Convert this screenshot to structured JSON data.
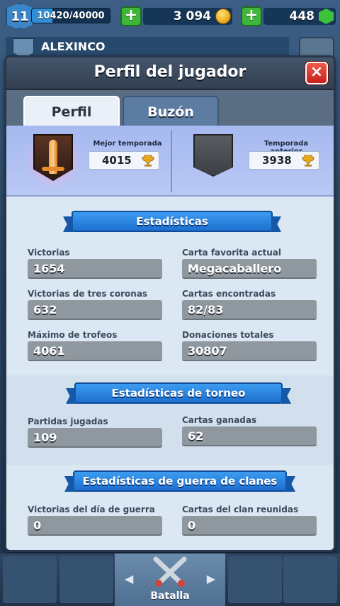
{
  "hud": {
    "level": "11",
    "xp_text": "10420/40000",
    "xp_fraction": 0.2605,
    "gold": "3 094",
    "gems": "448",
    "plus_label": "+"
  },
  "player": {
    "name": "ALEXINCO"
  },
  "modal": {
    "title": "Perfil del jugador",
    "close_label": "×",
    "tabs": [
      {
        "label": "Perfil",
        "active": true
      },
      {
        "label": "Buzón",
        "active": false
      }
    ]
  },
  "seasons": {
    "best": {
      "label": "Mejor temporada",
      "trophies": "4015"
    },
    "previous": {
      "label": "Temporada anterior",
      "trophies": "3938"
    }
  },
  "stats": {
    "title": "Estadísticas",
    "items": [
      {
        "label": "Victorias",
        "value": "1654"
      },
      {
        "label": "Carta favorita actual",
        "value": "Megacaballero"
      },
      {
        "label": "Victorias de tres coronas",
        "value": "632"
      },
      {
        "label": "Cartas encontradas",
        "value": "82/83"
      },
      {
        "label": "Máximo de trofeos",
        "value": "4061"
      },
      {
        "label": "Donaciones totales",
        "value": "30807"
      }
    ]
  },
  "tournament": {
    "title": "Estadísticas de torneo",
    "items": [
      {
        "label": "Partidas jugadas",
        "value": "109"
      },
      {
        "label": "Cartas ganadas",
        "value": "62"
      }
    ]
  },
  "clanwar": {
    "title": "Estadísticas de guerra de clanes",
    "items": [
      {
        "label": "Victorias del día de guerra",
        "value": "0"
      },
      {
        "label": "Cartas del clan reunidas",
        "value": "0"
      }
    ]
  },
  "nav": {
    "battle_label": "Batalla",
    "left_arrow": "◀",
    "right_arrow": "▶"
  },
  "colors": {
    "ribbon": "#2a86e0",
    "accent_close": "#e0302a",
    "plus_green": "#3fb63a"
  }
}
